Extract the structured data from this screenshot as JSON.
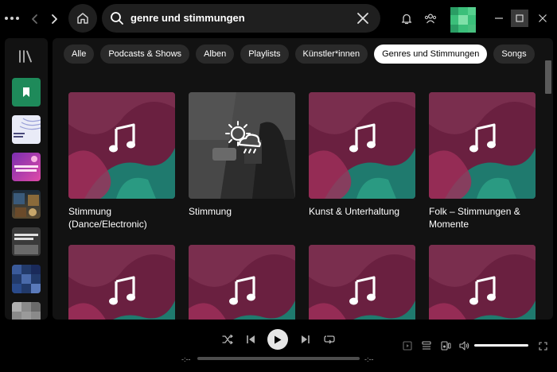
{
  "search": {
    "query": "genre und stimmungen",
    "placeholder": ""
  },
  "filters": [
    {
      "label": "Alle",
      "active": false
    },
    {
      "label": "Podcasts & Shows",
      "active": false
    },
    {
      "label": "Alben",
      "active": false
    },
    {
      "label": "Playlists",
      "active": false
    },
    {
      "label": "Künstler*innen",
      "active": false
    },
    {
      "label": "Genres und Stimmungen",
      "active": true
    },
    {
      "label": "Songs",
      "active": false
    }
  ],
  "cards": [
    {
      "title": "Stimmung (Dance/Electronic)",
      "icon": "music-note-icon"
    },
    {
      "title": "Stimmung",
      "icon": "weather-sun-rain-icon"
    },
    {
      "title": "Kunst & Unterhaltung",
      "icon": "music-note-icon"
    },
    {
      "title": "Folk – Stimmungen & Momente",
      "icon": "music-note-icon"
    },
    {
      "title": "",
      "icon": "music-note-icon"
    },
    {
      "title": "",
      "icon": "music-note-icon"
    },
    {
      "title": "",
      "icon": "music-note-icon"
    },
    {
      "title": "",
      "icon": "music-note-icon"
    }
  ],
  "sidebar_items": [
    {
      "name": "liked-songs",
      "color": "#1e8a5a"
    },
    {
      "name": "playlist-waves",
      "color": "#d9dcf0"
    },
    {
      "name": "playlist-regency-romance",
      "color": "#c33cc0"
    },
    {
      "name": "playlist-dark-art",
      "color": "#2b3a4a"
    },
    {
      "name": "playlist-sektion",
      "color": "#444444"
    },
    {
      "name": "playlist-blue",
      "color": "#2d4a8a"
    },
    {
      "name": "playlist-gray",
      "color": "#8a8a8a"
    }
  ],
  "player": {
    "time_elapsed": "-:--",
    "time_total": "-:--",
    "progress": 0,
    "volume": 1.0
  },
  "colors": {
    "accent": "#1ed760",
    "background": "#121212",
    "chip": "#2a2a2a"
  }
}
